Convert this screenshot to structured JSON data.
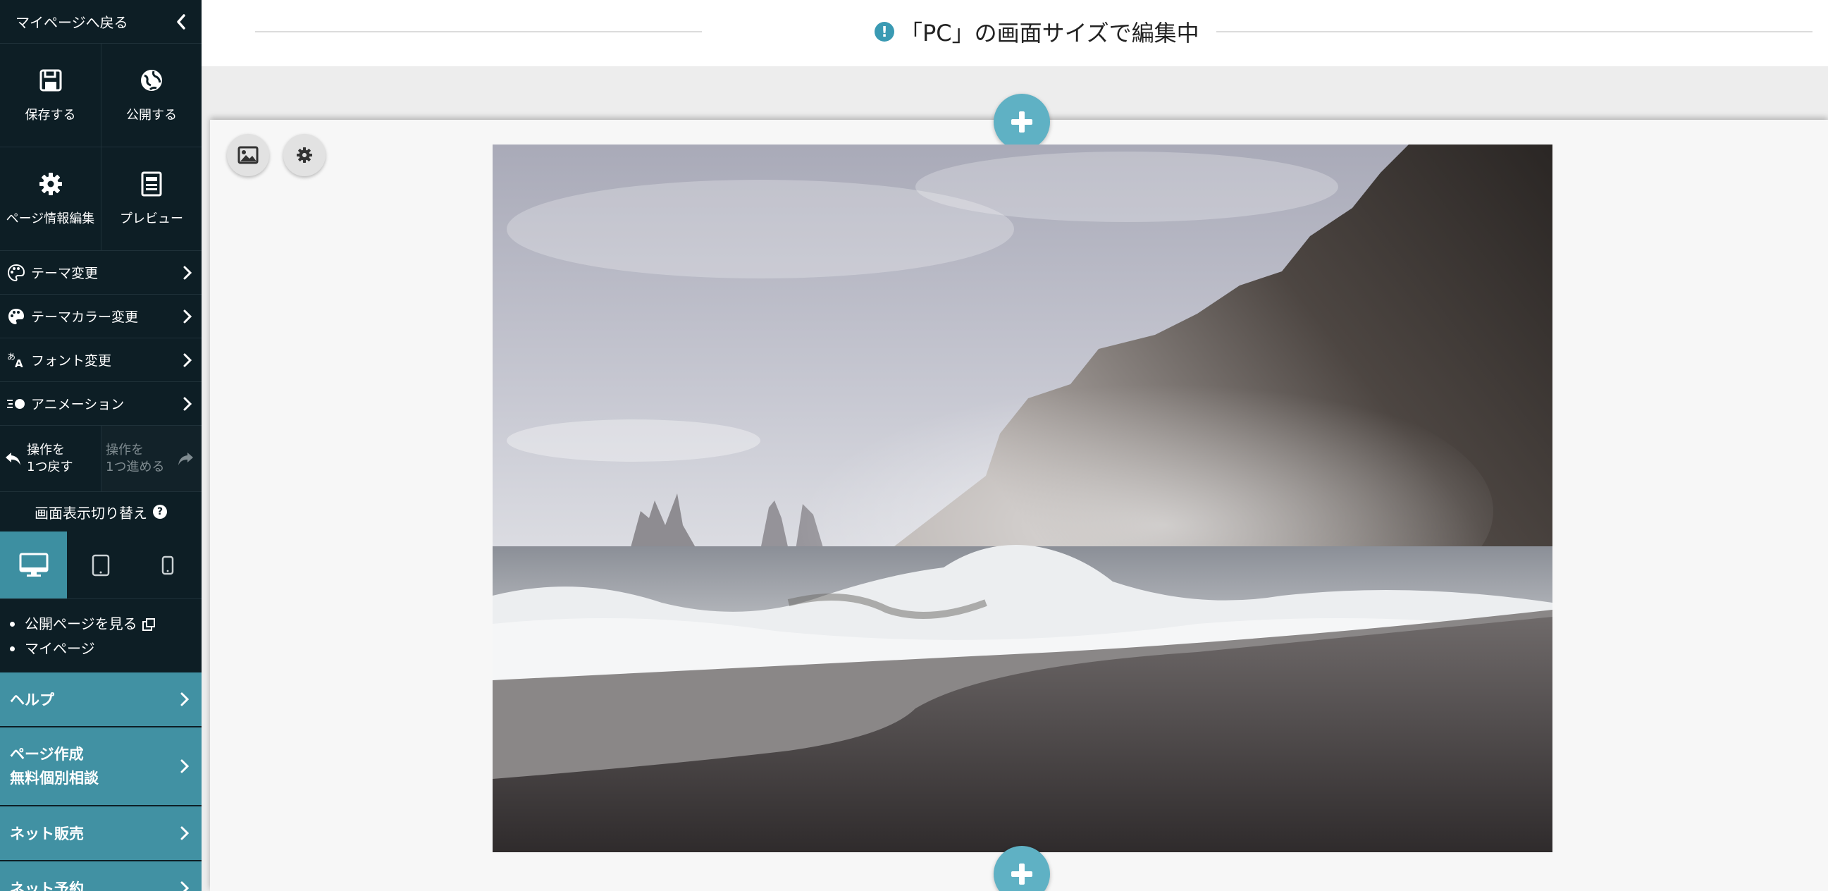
{
  "sidebar": {
    "back_label": "マイページへ戻る",
    "actions": [
      {
        "label": "保存する",
        "icon": "save-icon"
      },
      {
        "label": "公開する",
        "icon": "globe-icon"
      },
      {
        "label": "ページ情報編集",
        "icon": "gear-icon"
      },
      {
        "label": "プレビュー",
        "icon": "preview-icon"
      }
    ],
    "menu": [
      {
        "label": "テーマ変更",
        "icon": "palette-icon"
      },
      {
        "label": "テーマカラー変更",
        "icon": "palette-icon"
      },
      {
        "label": "フォント変更",
        "icon": "font-icon"
      },
      {
        "label": "アニメーション",
        "icon": "animation-icon"
      }
    ],
    "undo": {
      "line1": "操作を",
      "line2": "1つ戻す"
    },
    "redo": {
      "line1": "操作を",
      "line2": "1つ進める"
    },
    "display_switch_label": "画面表示切り替え",
    "display_switch_help": "?",
    "devices": [
      {
        "name": "pc",
        "icon": "desktop-icon",
        "active": true
      },
      {
        "name": "tablet",
        "icon": "tablet-icon",
        "active": false
      },
      {
        "name": "smartphone",
        "icon": "smartphone-icon",
        "active": false
      }
    ],
    "links": [
      {
        "label": "公開ページを見る",
        "icon": "external-link-icon"
      },
      {
        "label": "マイページ"
      }
    ],
    "teal_menu": [
      {
        "label": "ヘルプ"
      },
      {
        "line1": "ページ作成",
        "line2": "無料個別相談"
      },
      {
        "label": "ネット販売"
      },
      {
        "label": "ネット予約"
      }
    ]
  },
  "notice": {
    "icon_text": "!",
    "text": "「PC」の画面サイズで編集中"
  },
  "colors": {
    "sidebar_bg": "#0d1e25",
    "accent_teal": "#4191a3",
    "plus_button": "#5fb1c4"
  }
}
